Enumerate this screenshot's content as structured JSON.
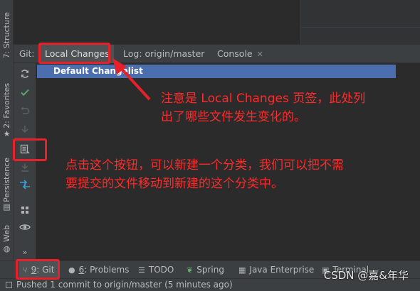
{
  "left_strip": {
    "structure_label": "7: Structure",
    "favorites_label": "2: Favorites",
    "persistence_label": "Persistence",
    "web_label": "Web"
  },
  "tool_window": {
    "title": "Git:",
    "tabs": [
      {
        "label": "Local Changes",
        "active": true
      },
      {
        "label": "Log: origin/master",
        "active": false
      },
      {
        "label": "Console",
        "active": false,
        "closable": true
      }
    ]
  },
  "changes": {
    "default_changelist": "Default Changelist"
  },
  "actions": {
    "icons": [
      "refresh-icon",
      "commit-check-icon",
      "rollback-icon",
      "shelve-icon",
      "new-changelist-icon",
      "update-icon",
      "diff-icon",
      "group-by-icon",
      "view-options-icon",
      "expand-more-icon"
    ],
    "more_glyph": "»"
  },
  "annotations": {
    "note1_line1": "注意是 Local Changes 页签，此处列",
    "note1_line2": "出了哪些文件发生变化的。",
    "note2_line1": "点击这个按钮，可以新建一个分类，我们可以把不需",
    "note2_line2": "要提交的文件移动到新建的这个分类中。",
    "color": "#ff2b2b"
  },
  "bottom_bar": {
    "git": {
      "num": "9",
      "label": ": Git"
    },
    "problems": {
      "num": "6",
      "label": ": Problems"
    },
    "todo": "TODO",
    "spring": "Spring",
    "java_enterprise": "Java Enterprise",
    "terminal": "Terminal"
  },
  "status_bar": {
    "message": "Pushed 1 commit to origin/master (5 minutes ago)"
  },
  "watermark": "CSDN @嘉&年华"
}
